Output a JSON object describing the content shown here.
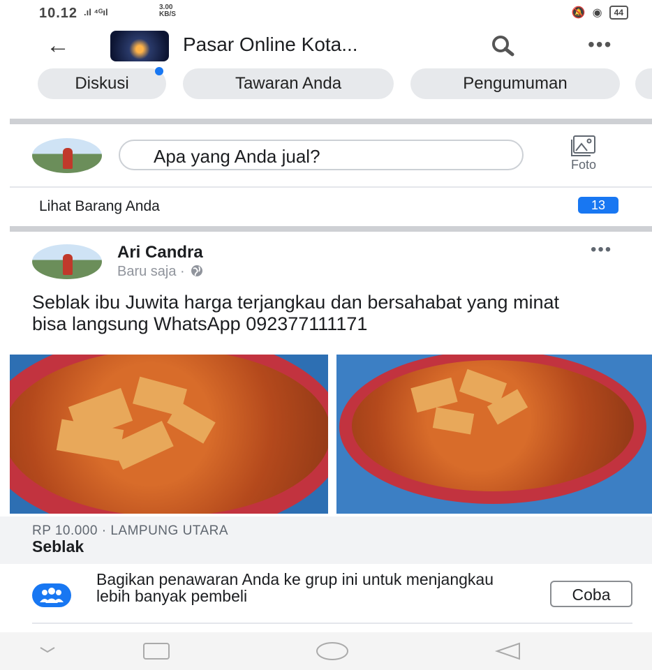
{
  "status_bar": {
    "time": "10.12",
    "signal": ".ıl ⁴ᴳıl",
    "speed_value": "3.00",
    "speed_unit": "KB/S",
    "battery": "44"
  },
  "header": {
    "group_name": "Pasar Online Kota...",
    "icons": [
      "back-arrow-icon",
      "search-icon",
      "more-icon"
    ]
  },
  "tabs": [
    {
      "label": "Diskusi",
      "has_dot": true
    },
    {
      "label": "Tawaran Anda"
    },
    {
      "label": "Pengumuman"
    }
  ],
  "composer": {
    "placeholder": "Apa yang Anda jual?",
    "photo_label": "Foto"
  },
  "your_items": {
    "label": "Lihat Barang Anda",
    "count": "13"
  },
  "post": {
    "author": "Ari Candra",
    "time": "Baru saja ·",
    "text": "Seblak ibu Juwita harga terjangkau dan bersahabat yang minat bisa langsung WhatsApp 092377111171",
    "listing_price": "RP 10.000 · LAMPUNG UTARA",
    "listing_title": "Seblak"
  },
  "share_prompt": {
    "text": "Bagikan penawaran Anda ke grup ini untuk menjangkau lebih banyak pembeli",
    "button": "Coba"
  },
  "colors": {
    "accent": "#1877f2",
    "chip_bg": "#e7e9ec",
    "divider": "#ced0d4"
  }
}
